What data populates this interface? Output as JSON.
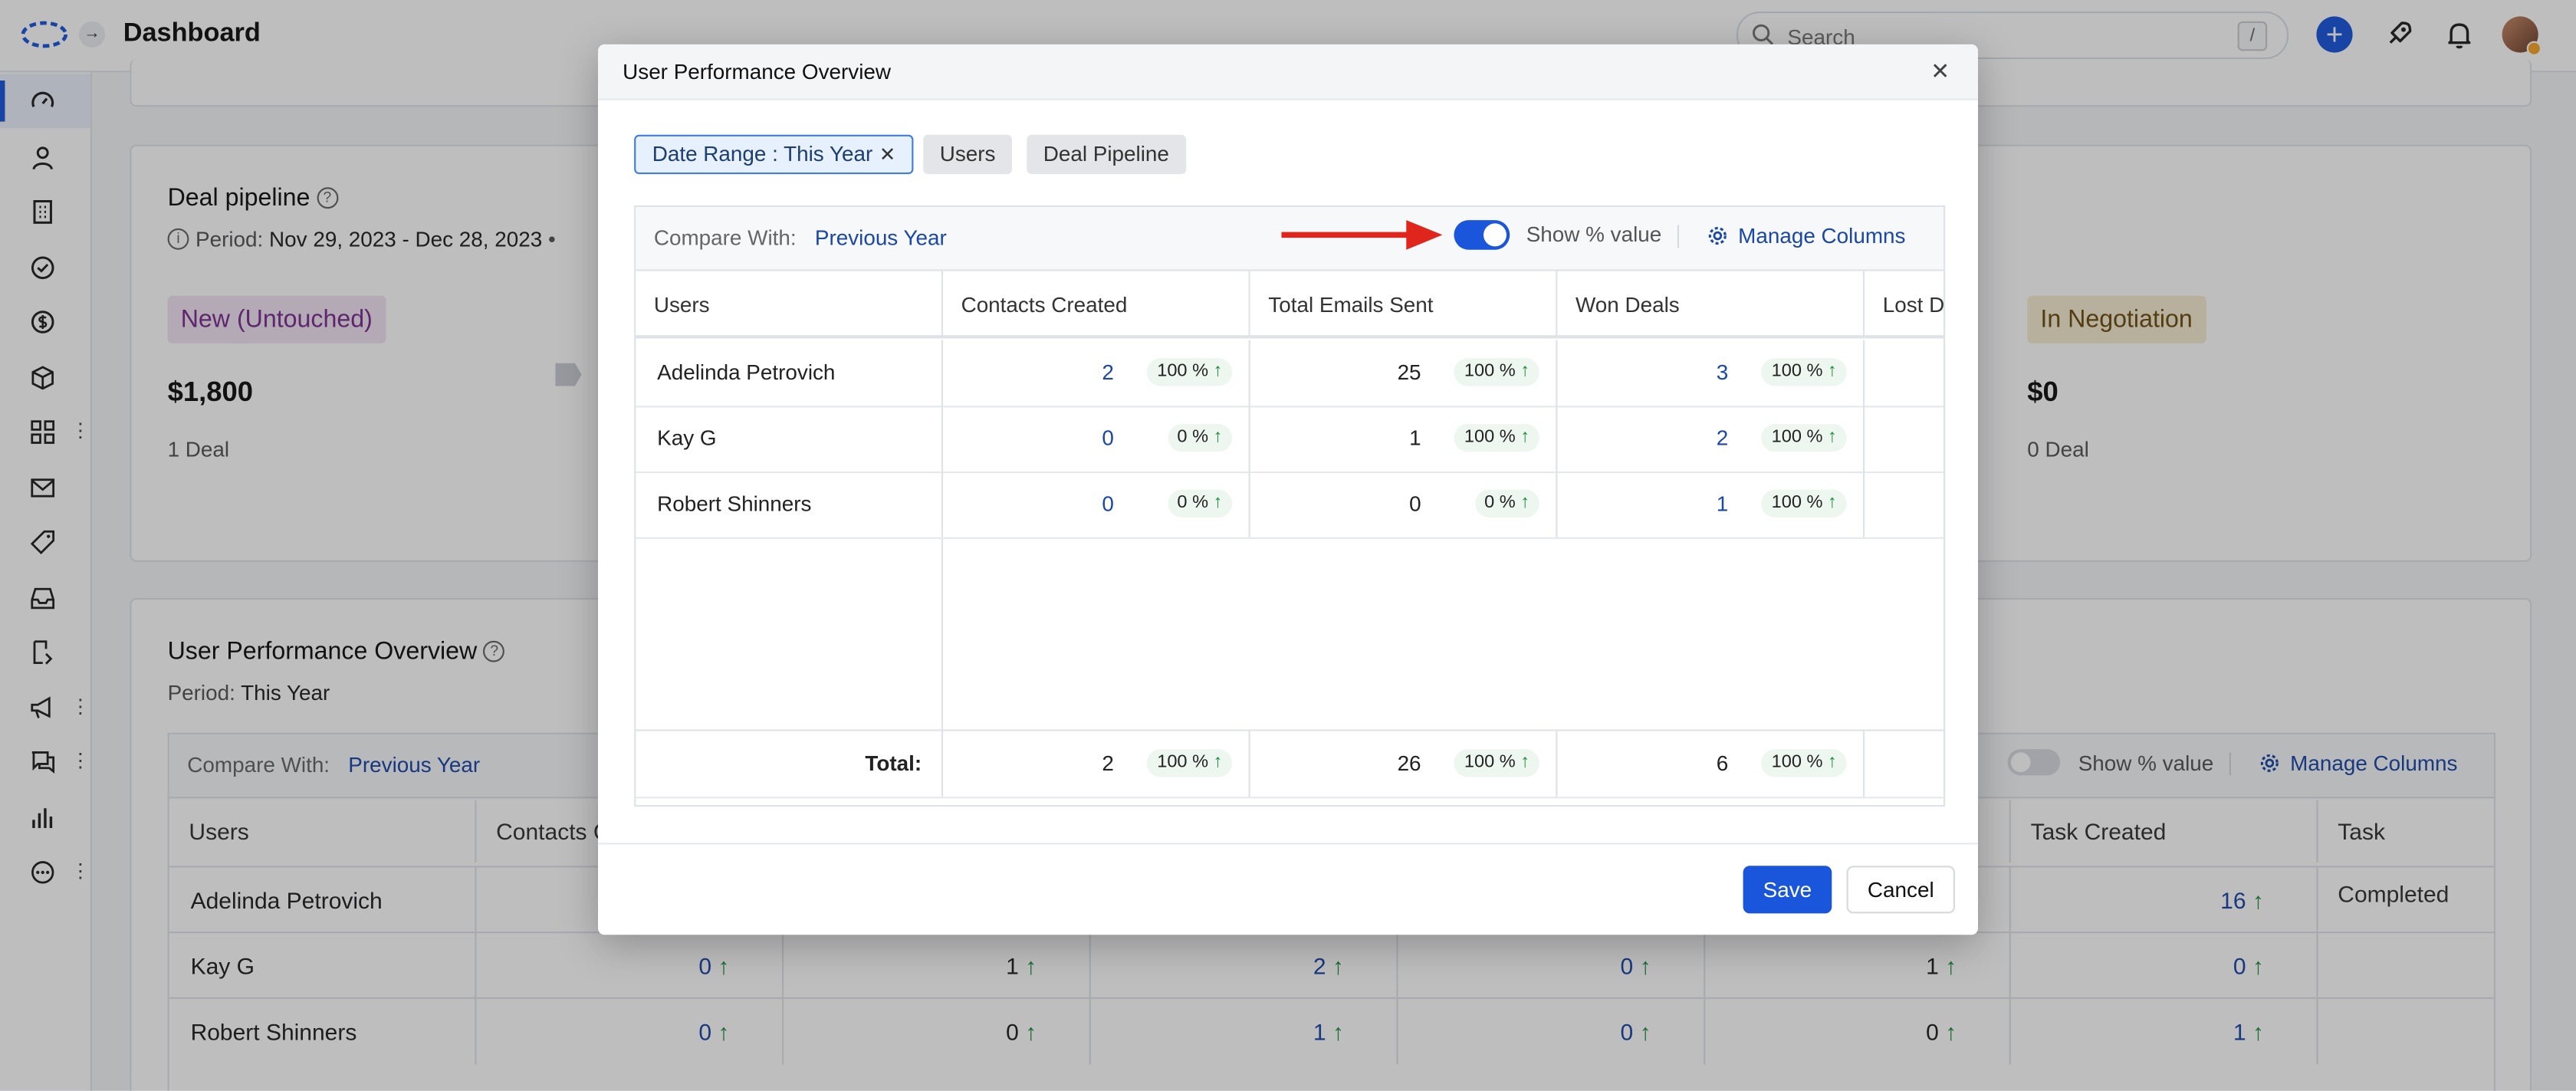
{
  "topbar": {
    "title": "Dashboard",
    "search_placeholder": "Search",
    "search_shortcut": "/"
  },
  "sidebar": {
    "items": [
      {
        "icon": "speedometer-icon",
        "active": true
      },
      {
        "icon": "contact-icon"
      },
      {
        "icon": "building-icon"
      },
      {
        "icon": "check-circle-icon"
      },
      {
        "icon": "dollar-icon"
      },
      {
        "icon": "box-icon"
      },
      {
        "icon": "apps-icon",
        "kebab": true
      },
      {
        "icon": "mail-icon"
      },
      {
        "icon": "tag-icon"
      },
      {
        "icon": "inbox-icon"
      },
      {
        "icon": "workflow-icon"
      },
      {
        "icon": "megaphone-icon",
        "kebab": true
      },
      {
        "icon": "chat-icon",
        "kebab": true
      },
      {
        "icon": "bar-chart-icon"
      },
      {
        "icon": "more-circle-icon",
        "kebab": true
      }
    ]
  },
  "deal_pipeline": {
    "title": "Deal pipeline",
    "period_label": "Period:",
    "period_value": "Nov 29, 2023 - Dec 28, 2023",
    "stages": [
      {
        "name": "New (Untouched)",
        "amount": "$1,800",
        "count": "1 Deal",
        "color": "#f0e3f3",
        "text_color": "#7b2d8e"
      },
      {
        "name": "In Negotiation",
        "amount": "$0",
        "count": "0 Deal",
        "color": "#f6ecd0",
        "text_color": "#6b4e12"
      }
    ]
  },
  "user_performance": {
    "title": "User Performance Overview",
    "period_label": "Period:",
    "period_value": "This Year",
    "compare_label": "Compare With:",
    "compare_value": "Previous Year",
    "toggle_label": "Show % value",
    "manage_columns": "Manage Columns",
    "columns": [
      "Users",
      "Contacts C",
      "Task Created",
      "Task Completed"
    ],
    "rows": [
      {
        "user": "Adelinda Petrovich",
        "c1": "",
        "c2": "",
        "c3": "",
        "c4": "",
        "c5": "",
        "task_created": "16",
        "task_completed": ""
      },
      {
        "user": "Kay G",
        "c1": "0",
        "c2": "1",
        "c3": "2",
        "c4": "0",
        "c5": "1",
        "task_created": "0",
        "task_completed": ""
      },
      {
        "user": "Robert Shinners",
        "c1": "0",
        "c2": "0",
        "c3": "1",
        "c4": "0",
        "c5": "0",
        "task_created": "1",
        "task_completed": ""
      }
    ]
  },
  "modal": {
    "title": "User Performance Overview",
    "chips": [
      {
        "label": "Date Range : This Year",
        "active": true
      },
      {
        "label": "Users",
        "active": false
      },
      {
        "label": "Deal Pipeline",
        "active": false
      }
    ],
    "compare_label": "Compare With:",
    "compare_value": "Previous Year",
    "toggle_label": "Show % value",
    "toggle_on": true,
    "manage_columns": "Manage Columns",
    "columns": [
      "Users",
      "Contacts Created",
      "Total Emails Sent",
      "Won Deals",
      "Lost D"
    ],
    "rows": [
      {
        "user": "Adelinda Petrovich",
        "contacts": "2",
        "contacts_pct": "100 %",
        "emails": "25",
        "emails_pct": "100 %",
        "won": "3",
        "won_pct": "100 %"
      },
      {
        "user": "Kay G",
        "contacts": "0",
        "contacts_pct": "0 %",
        "emails": "1",
        "emails_pct": "100 %",
        "won": "2",
        "won_pct": "100 %"
      },
      {
        "user": "Robert Shinners",
        "contacts": "0",
        "contacts_pct": "0 %",
        "emails": "0",
        "emails_pct": "0 %",
        "won": "1",
        "won_pct": "100 %"
      }
    ],
    "total": {
      "label": "Total:",
      "contacts": "2",
      "contacts_pct": "100 %",
      "emails": "26",
      "emails_pct": "100 %",
      "won": "6",
      "won_pct": "100 %"
    },
    "save": "Save",
    "cancel": "Cancel"
  },
  "colors": {
    "accent": "#1a56db",
    "link": "#1a47a8",
    "up_arrow": "#1e8e3e",
    "annotation_arrow": "#e0261c"
  }
}
